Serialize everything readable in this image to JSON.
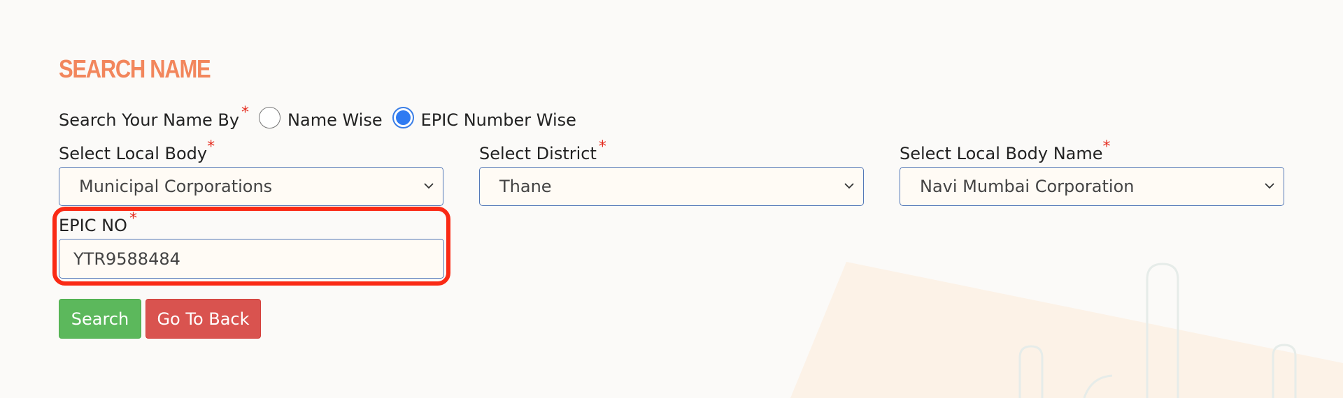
{
  "page_title": "SEARCH NAME",
  "search_by": {
    "label": "Search Your Name By",
    "required_mark": "*",
    "options": [
      {
        "label": "Name Wise",
        "selected": false
      },
      {
        "label": "EPIC Number Wise",
        "selected": true
      }
    ]
  },
  "fields": {
    "local_body": {
      "label": "Select Local Body",
      "required_mark": "*",
      "value": "Municipal Corporations"
    },
    "district": {
      "label": "Select District",
      "required_mark": "*",
      "value": "Thane"
    },
    "local_body_name": {
      "label": "Select Local Body Name",
      "required_mark": "*",
      "value": "Navi Mumbai Corporation"
    },
    "epic_no": {
      "label": "EPIC NO",
      "required_mark": "*",
      "value": "YTR9588484"
    }
  },
  "buttons": {
    "search": "Search",
    "back": "Go To Back"
  },
  "colors": {
    "title": "#f2865c",
    "required": "#e42a1d",
    "search_button": "#5cb85c",
    "back_button": "#d9534f",
    "highlight": "#fa2a15",
    "radio_selected": "#2f7bf2"
  }
}
